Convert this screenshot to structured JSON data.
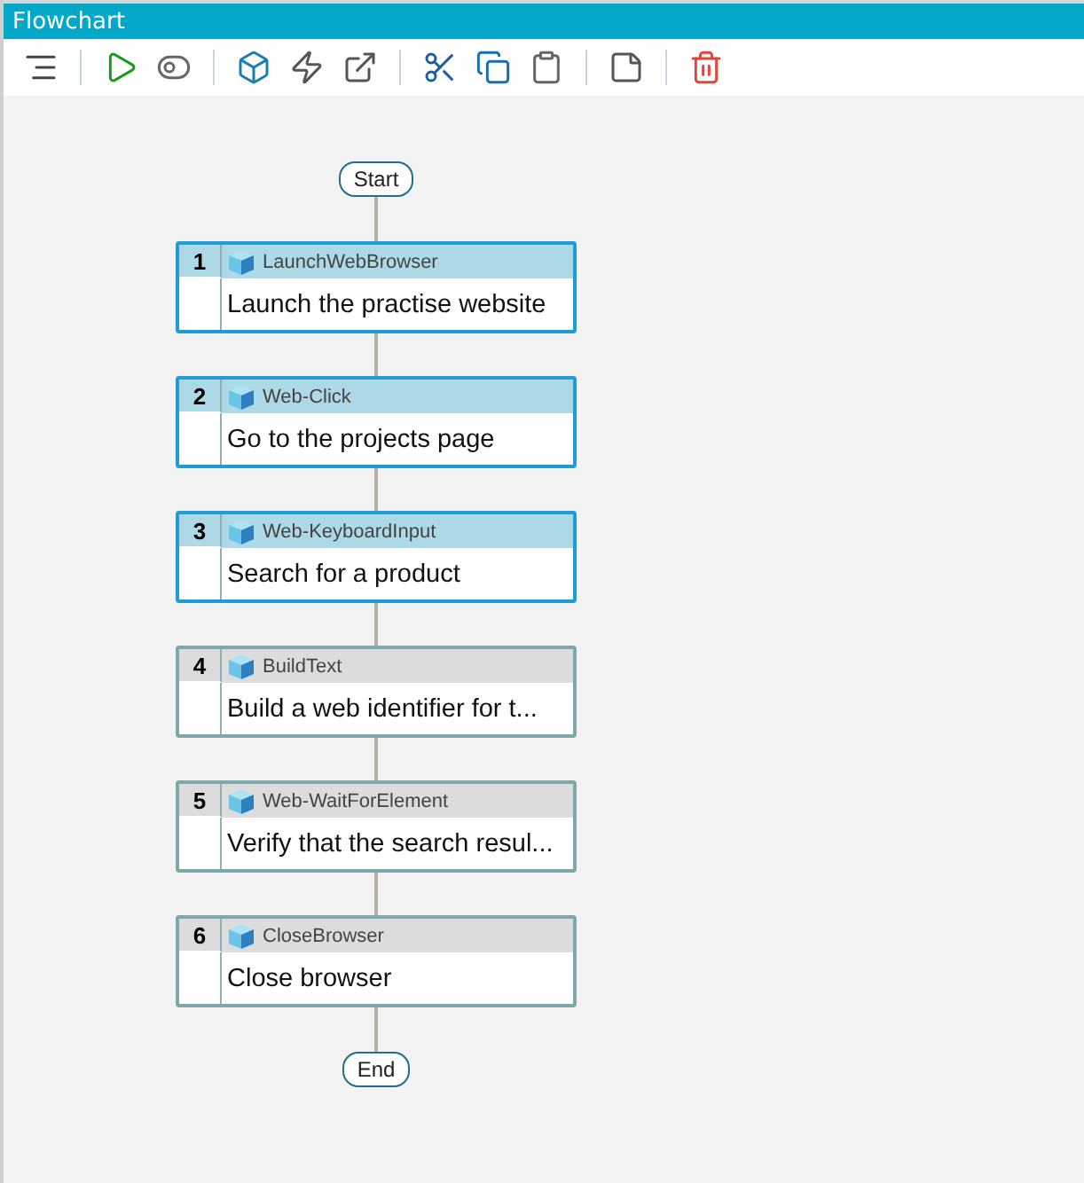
{
  "window": {
    "title": "Flowchart"
  },
  "toolbar": [
    {
      "kind": "lines"
    },
    {
      "kind": "sep"
    },
    {
      "kind": "play"
    },
    {
      "kind": "toggle"
    },
    {
      "kind": "sep"
    },
    {
      "kind": "cube"
    },
    {
      "kind": "bolt"
    },
    {
      "kind": "external"
    },
    {
      "kind": "sep"
    },
    {
      "kind": "scissors"
    },
    {
      "kind": "copy"
    },
    {
      "kind": "paste"
    },
    {
      "kind": "sep"
    },
    {
      "kind": "note"
    },
    {
      "kind": "sep"
    },
    {
      "kind": "trash"
    }
  ],
  "flow": {
    "start": "Start",
    "end": "End",
    "steps": [
      {
        "number": "1",
        "action": "LaunchWebBrowser",
        "description": "Launch the practise website",
        "selected": true
      },
      {
        "number": "2",
        "action": "Web-Click",
        "description": "Go to the projects page",
        "selected": true
      },
      {
        "number": "3",
        "action": "Web-KeyboardInput",
        "description": "Search for a product",
        "selected": true
      },
      {
        "number": "4",
        "action": "BuildText",
        "description": "Build a web identifier for t...",
        "selected": false
      },
      {
        "number": "5",
        "action": "Web-WaitForElement",
        "description": "Verify that the search resul...",
        "selected": false
      },
      {
        "number": "6",
        "action": "CloseBrowser",
        "description": "Close browser",
        "selected": false
      }
    ]
  }
}
